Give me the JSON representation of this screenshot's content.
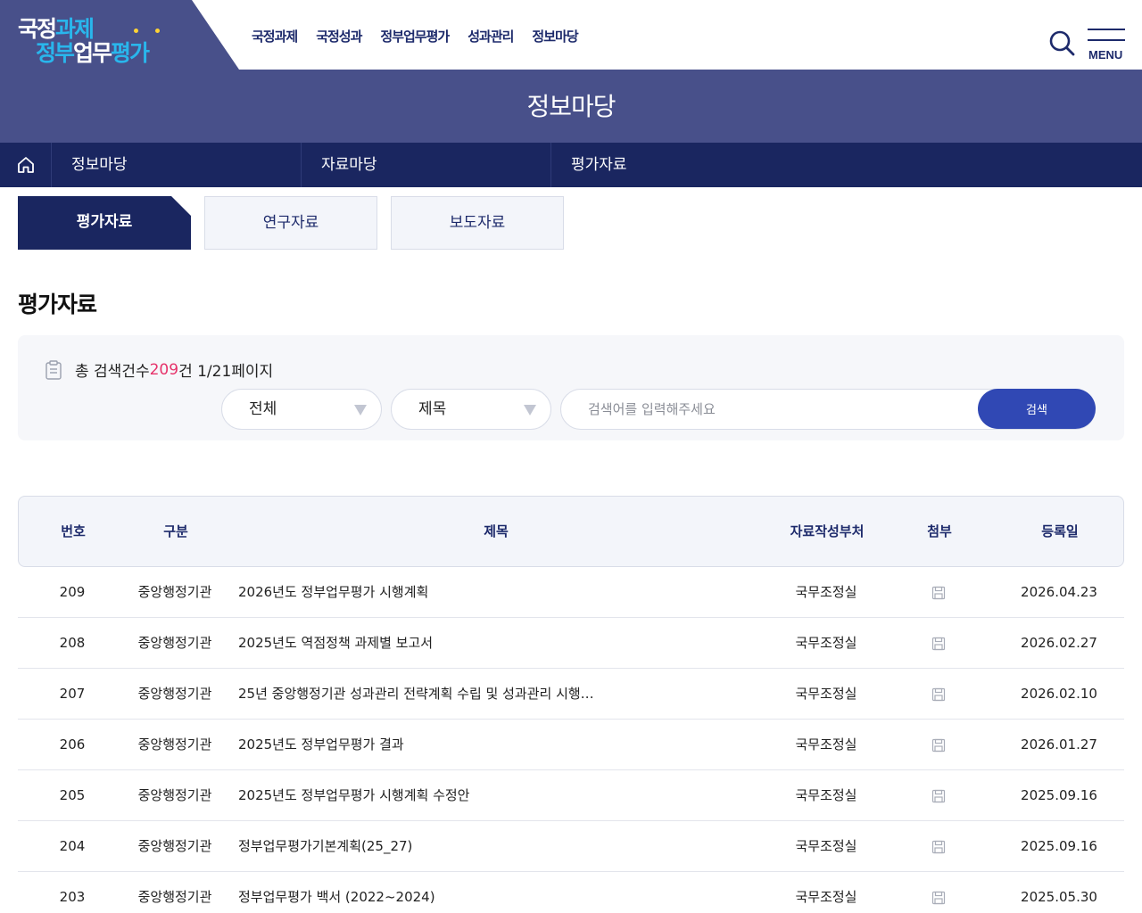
{
  "logo": {
    "line1": [
      "국정",
      "과제"
    ],
    "line2": [
      "정부",
      "업무",
      "평가"
    ]
  },
  "gnb": [
    "국정과제",
    "국정성과",
    "정부업무평가",
    "성과관리",
    "정보마당"
  ],
  "menu_label": "MENU",
  "page_title": "정보마당",
  "lnb": [
    "정보마당",
    "자료마당",
    "평가자료"
  ],
  "tabs": [
    "평가자료",
    "연구자료",
    "보도자료"
  ],
  "section_title": "평가자료",
  "search": {
    "count_prefix": "총 검색건수 ",
    "count": "209",
    "count_suffix": "건 1/21페이지",
    "category_select": "전체",
    "field_select": "제목",
    "placeholder": "검색어를 입력해주세요",
    "submit_label": "검색"
  },
  "table": {
    "headers": [
      "번호",
      "구분",
      "제목",
      "자료작성부처",
      "첨부",
      "등록일"
    ],
    "rows": [
      {
        "no": "209",
        "category": "중앙행정기관",
        "title": "2026년도 정부업무평가 시행계획",
        "dept": "국무조정실",
        "date": "2026.04.23"
      },
      {
        "no": "208",
        "category": "중앙행정기관",
        "title": "2025년도 역점정책 과제별 보고서",
        "dept": "국무조정실",
        "date": "2026.02.27"
      },
      {
        "no": "207",
        "category": "중앙행정기관",
        "title": "25년 중앙행정기관 성과관리 전략계획 수립 및 성과관리 시행…",
        "dept": "국무조정실",
        "date": "2026.02.10"
      },
      {
        "no": "206",
        "category": "중앙행정기관",
        "title": "2025년도 정부업무평가 결과",
        "dept": "국무조정실",
        "date": "2026.01.27"
      },
      {
        "no": "205",
        "category": "중앙행정기관",
        "title": "2025년도 정부업무평가 시행계획 수정안",
        "dept": "국무조정실",
        "date": "2025.09.16"
      },
      {
        "no": "204",
        "category": "중앙행정기관",
        "title": "정부업무평가기본계획(25_27)",
        "dept": "국무조정실",
        "date": "2025.09.16"
      },
      {
        "no": "203",
        "category": "중앙행정기관",
        "title": "정부업무평가 백서 (2022~2024)",
        "dept": "국무조정실",
        "date": "2025.05.30"
      }
    ]
  },
  "colors": {
    "primary_navy": "#1a2660",
    "band": "#48508a",
    "accent_blue": "#3048b4",
    "count_highlight": "#e6326a",
    "logo_cyan": "#29b6ec"
  },
  "icons": {
    "search": "search-icon",
    "menu": "hamburger-icon",
    "home": "home-icon",
    "count": "clipboard-icon",
    "attachment": "file-icon",
    "select_caret": "caret-down-icon"
  }
}
